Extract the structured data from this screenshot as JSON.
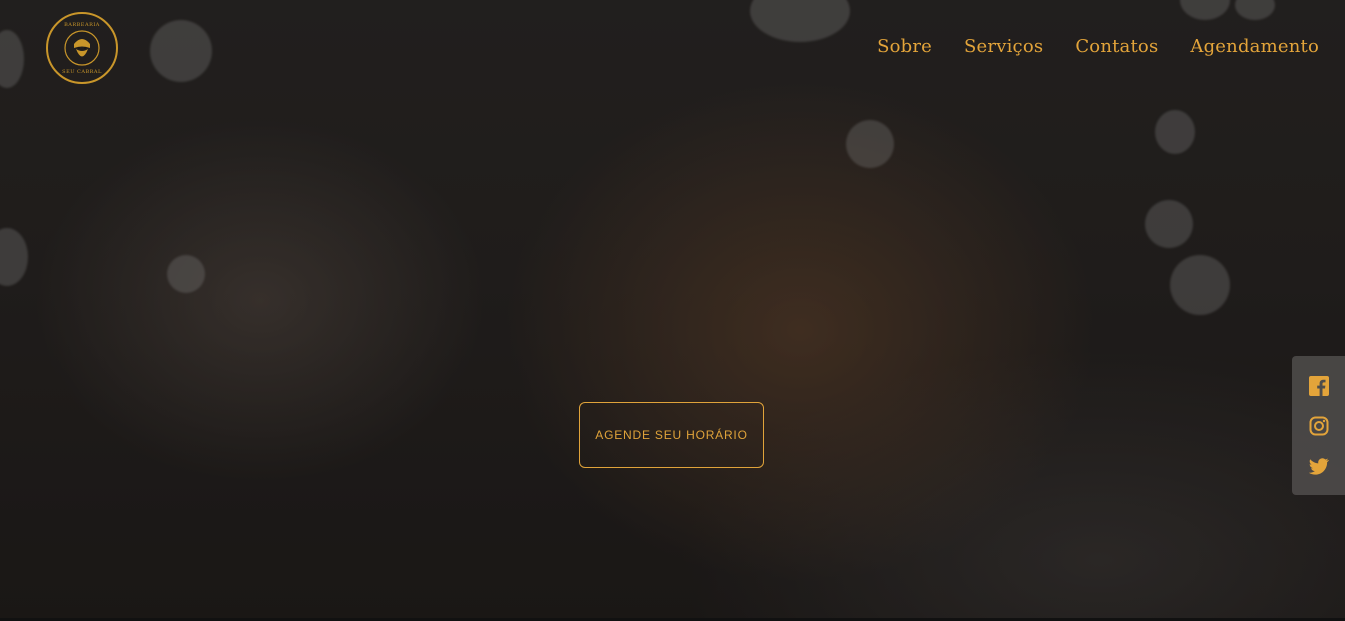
{
  "brand": {
    "logo_top_text": "BARBEARIA",
    "logo_bottom_text": "SEU CABRAL",
    "accent_color": "#e3a43a"
  },
  "nav": {
    "items": [
      {
        "label": "Sobre"
      },
      {
        "label": "Serviços"
      },
      {
        "label": "Contatos"
      },
      {
        "label": "Agendamento"
      }
    ]
  },
  "hero": {
    "cta_label": "AGENDE SEU HORÁRIO"
  },
  "social": {
    "icons": [
      "facebook-icon",
      "instagram-icon",
      "twitter-icon"
    ]
  }
}
